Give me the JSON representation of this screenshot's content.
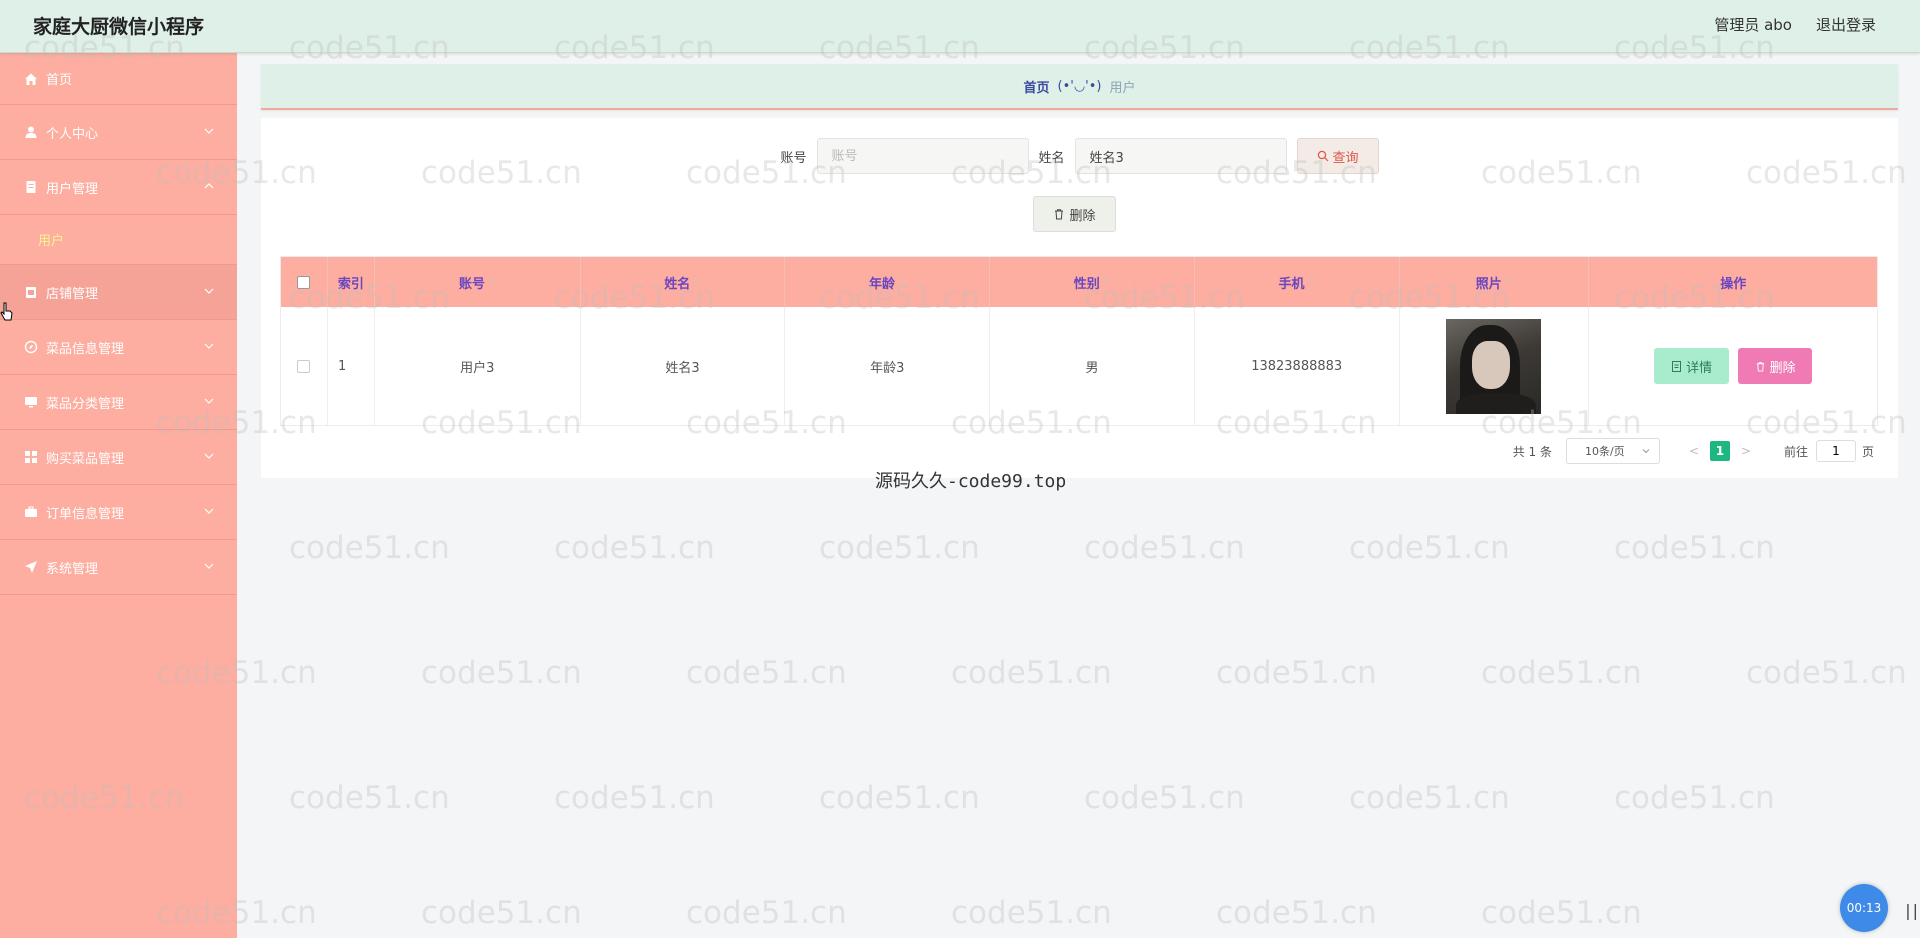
{
  "app": {
    "title": "家庭大厨微信小程序"
  },
  "topbar": {
    "user": "管理员 abo",
    "logout": "退出登录"
  },
  "sidebar": {
    "items": [
      {
        "label": "首页",
        "icon": "home-icon"
      },
      {
        "label": "个人中心",
        "icon": "user-icon"
      },
      {
        "label": "用户管理",
        "icon": "doc-icon",
        "sub": "用户"
      },
      {
        "label": "店铺管理",
        "icon": "shop-icon"
      },
      {
        "label": "菜品信息管理",
        "icon": "compass-icon"
      },
      {
        "label": "菜品分类管理",
        "icon": "monitor-icon"
      },
      {
        "label": "购买菜品管理",
        "icon": "grid-icon"
      },
      {
        "label": "订单信息管理",
        "icon": "briefcase-icon"
      },
      {
        "label": "系统管理",
        "icon": "navigate-icon"
      }
    ]
  },
  "breadcrumb": {
    "home": "首页",
    "sep": "(•'◡'•)",
    "current": "用户"
  },
  "search": {
    "account_label": "账号",
    "account_placeholder": "账号",
    "account_value": "",
    "name_label": "姓名",
    "name_value": "姓名3",
    "query_label": "查询"
  },
  "toolbar": {
    "delete_label": "删除"
  },
  "table": {
    "headers": [
      "索引",
      "账号",
      "姓名",
      "年龄",
      "性别",
      "手机",
      "照片",
      "操作"
    ],
    "rows": [
      {
        "index": "1",
        "account": "用户3",
        "name": "姓名3",
        "age": "年龄3",
        "sex": "男",
        "phone": "13823888883"
      }
    ],
    "detail_label": "详情",
    "delete_label": "删除"
  },
  "pagination": {
    "total": "共 1 条",
    "page_size": "10条/页",
    "current_page": "1",
    "goto_label": "前往",
    "goto_value": "1",
    "unit": "页"
  },
  "footer_note": "源码久久-code99.top",
  "watermark": "code51.cn",
  "recorder": {
    "time": "00:13"
  }
}
